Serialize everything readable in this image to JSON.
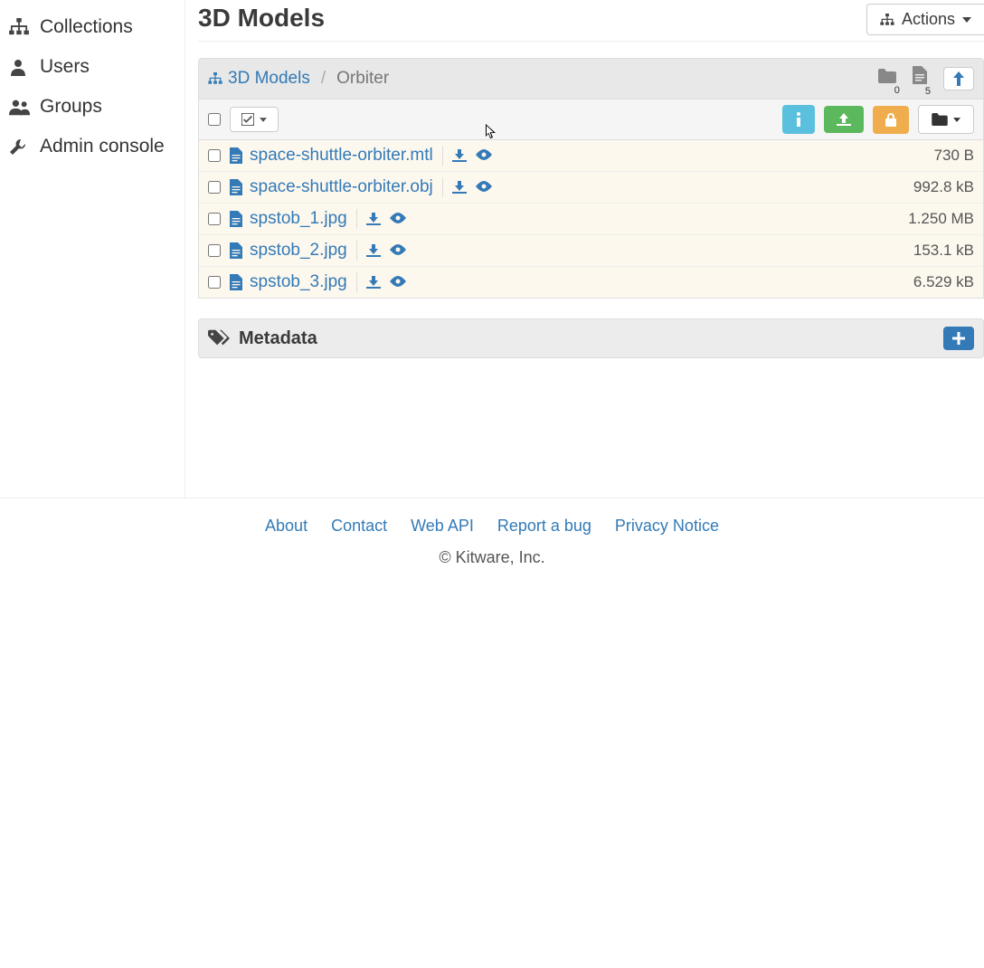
{
  "sidebar": {
    "items": [
      {
        "icon": "sitemap",
        "label": "Collections"
      },
      {
        "icon": "user",
        "label": "Users"
      },
      {
        "icon": "users",
        "label": "Groups"
      },
      {
        "icon": "wrench",
        "label": "Admin console"
      }
    ]
  },
  "header": {
    "title": "3D Models",
    "actions_label": "Actions"
  },
  "breadcrumb": {
    "root_label": "3D Models",
    "current": "Orbiter",
    "folder_count": "0",
    "file_count": "5"
  },
  "files": [
    {
      "name": "space-shuttle-orbiter.mtl",
      "size": "730 B"
    },
    {
      "name": "space-shuttle-orbiter.obj",
      "size": "992.8 kB"
    },
    {
      "name": "spstob_1.jpg",
      "size": "1.250 MB"
    },
    {
      "name": "spstob_2.jpg",
      "size": "153.1 kB"
    },
    {
      "name": "spstob_3.jpg",
      "size": "6.529 kB"
    }
  ],
  "metadata": {
    "label": "Metadata"
  },
  "footer": {
    "links": [
      "About",
      "Contact",
      "Web API",
      "Report a bug",
      "Privacy Notice"
    ],
    "copyright": "© Kitware, Inc."
  }
}
